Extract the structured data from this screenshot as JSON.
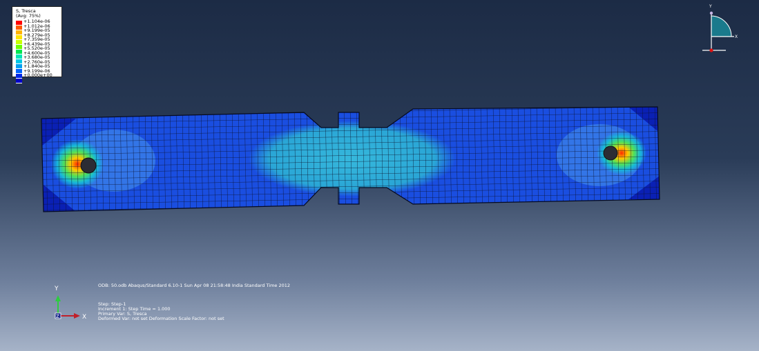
{
  "legend": {
    "title": "S, Tresca",
    "subtitle": "(Avg: 75%)",
    "values": [
      "+1.104e-06",
      "+1.012e-06",
      "+9.199e-05",
      "+8.279e-05",
      "+7.359e-05",
      "+6.439e-05",
      "+5.520e-05",
      "+4.600e-05",
      "+3.680e-05",
      "+2.760e-05",
      "+1.840e-05",
      "+9.199e-06",
      "+0.000e+00"
    ],
    "colors": [
      "#ff0000",
      "#ff5a00",
      "#ffb400",
      "#ffe600",
      "#c8ff00",
      "#6eff00",
      "#00e650",
      "#00e6b4",
      "#00c8e6",
      "#00a0f0",
      "#0064ff",
      "#0028e6",
      "#0000c8"
    ]
  },
  "info": {
    "odb_line": "ODB: 50.odb    Abaqus/Standard 6.10-1    Sun Apr 08 21:58:48 India Standard Time 2012",
    "step_line": "Step: Step-1",
    "increment_line": "Increment      1: Step Time =    1.000",
    "primary_var_line": "Primary Var: S, Tresca",
    "deformed_var_line": "Deformed Var: not set    Deformation Scale Factor: not set"
  },
  "triad": {
    "y_label": "Y",
    "x_label": "X"
  },
  "axes2d": {
    "y_label": "Y",
    "x_label": "X",
    "z_label": "Z"
  },
  "colors": {
    "mesh_edge": "#0a0f2a",
    "base_blue": "#1a4ee0",
    "mid_cyan": "#2eaad8"
  }
}
